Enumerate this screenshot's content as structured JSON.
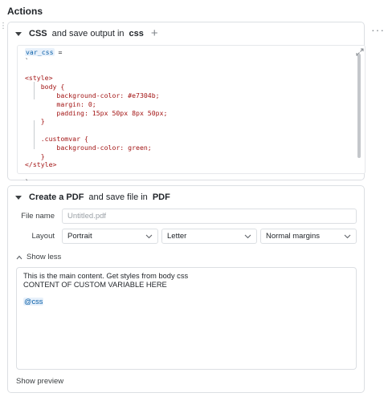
{
  "section_title": "Actions",
  "css_action": {
    "label_name": "CSS",
    "label_mid": "and save output in",
    "label_var": "css",
    "plus_glyph": "+",
    "code_lines": [
      {
        "text": "",
        "token": "var_css",
        "after": " =",
        "cls": "black"
      },
      {
        "text": "`",
        "cls": "black"
      },
      {
        "text": "",
        "cls": "black"
      },
      {
        "text": "<style>"
      },
      {
        "text": "    body {"
      },
      {
        "text": "        background-color: #e7304b;"
      },
      {
        "text": "        margin: 0;"
      },
      {
        "text": "        padding: 15px 50px 8px 50px;"
      },
      {
        "text": "    }"
      },
      {
        "text": ""
      },
      {
        "text": "    .customvar {"
      },
      {
        "text": "        background-color: green;"
      },
      {
        "text": "    }"
      },
      {
        "text": "</style>"
      },
      {
        "text": ""
      },
      {
        "text": "`",
        "cls": "black"
      }
    ]
  },
  "pdf_action": {
    "label_a": "Create a",
    "label_b": "PDF",
    "label_c": "and save file in",
    "label_d": "PDF",
    "file_name_label": "File name",
    "file_name_placeholder": "Untitled.pdf",
    "layout_label": "Layout",
    "orientation": "Portrait",
    "paper": "Letter",
    "margins": "Normal margins",
    "toggle_label": "Show less",
    "content_line1": "This is the main content. Get styles from body css",
    "content_line2": "CONTENT OF CUSTOM VARIABLE HERE",
    "content_mention": "@css",
    "preview_label": "Show preview"
  }
}
